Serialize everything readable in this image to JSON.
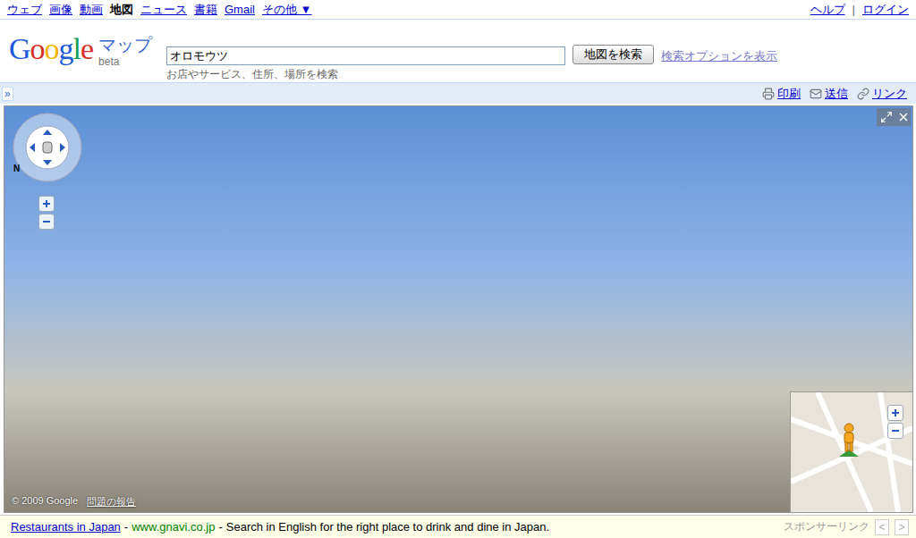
{
  "top_nav": {
    "links": [
      {
        "label": "ウェブ",
        "selected": false
      },
      {
        "label": "画像",
        "selected": false
      },
      {
        "label": "動画",
        "selected": false
      },
      {
        "label": "地図",
        "selected": true
      },
      {
        "label": "ニュース",
        "selected": false
      },
      {
        "label": "書籍",
        "selected": false
      },
      {
        "label": "Gmail",
        "selected": false
      },
      {
        "label": "その他 ▼",
        "selected": false
      }
    ],
    "right_links": [
      "ヘルプ",
      "ログイン"
    ],
    "separator": "|"
  },
  "header": {
    "logo": "Google",
    "product": "マップ",
    "badge": "beta",
    "search_value": "オロモウツ",
    "search_hint": "お店やサービス、住所、場所を検索",
    "search_button": "地図を検索",
    "options_link": "検索オプションを表示"
  },
  "toolbar": {
    "toggle": "»",
    "actions": [
      {
        "label": "印刷",
        "kind": "print"
      },
      {
        "label": "送信",
        "kind": "mail"
      },
      {
        "label": "リンク",
        "kind": "link"
      }
    ]
  },
  "street_view": {
    "compass": "N",
    "copyright": "© 2009 Google",
    "report": "問題の報告"
  },
  "ad_bar": {
    "title": "Restaurants in Japan",
    "separator": "-",
    "url": "www.gnavi.co.jp",
    "text": "Search in English for the right place to drink and dine in Japan.",
    "label": "スポンサーリンク",
    "prev": "<",
    "next": ">"
  }
}
